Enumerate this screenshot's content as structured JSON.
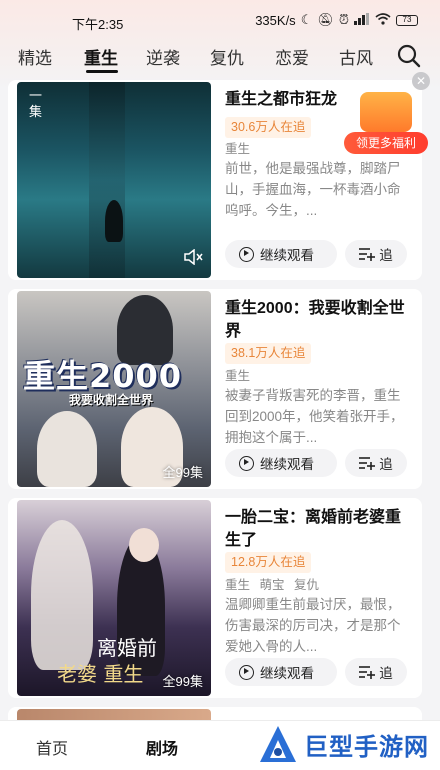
{
  "status_bar": {
    "time": "下午2:35",
    "network_speed": "335K/s",
    "battery": "73"
  },
  "tabs": [
    {
      "label": "精选",
      "active": false
    },
    {
      "label": "重生",
      "active": true
    },
    {
      "label": "逆袭",
      "active": false
    },
    {
      "label": "复仇",
      "active": false
    },
    {
      "label": "恋爱",
      "active": false
    },
    {
      "label": "古风",
      "active": false
    }
  ],
  "welfare": {
    "label": "领更多福利"
  },
  "dramas": [
    {
      "title": "重生之都市狂龙",
      "followers": "30.6万人在追",
      "tags": [
        "重生"
      ],
      "description": "前世，他是最强战尊，脚踏尸山，手握血海，一杯毒酒小命呜呼。今生，...",
      "episode_label": "一集",
      "continue_label": "继续观看",
      "follow_label": "追"
    },
    {
      "title": "重生2000：我要收割全世界",
      "followers": "38.1万人在追",
      "tags": [
        "重生"
      ],
      "description": "被妻子背叛害死的李晋，重生回到2000年，他笑着张开手，拥抱这个属于...",
      "episode_label": "全99集",
      "poster_title": "重生2000",
      "poster_subtitle": "我要收割全世界",
      "continue_label": "继续观看",
      "follow_label": "追"
    },
    {
      "title": "一胎二宝：离婚前老婆重生了",
      "followers": "12.8万人在追",
      "tags": [
        "重生",
        "萌宝",
        "复仇"
      ],
      "description": "温卿卿重生前最讨厌，最恨，伤害最深的厉司决，才是那个爱她入骨的人...",
      "episode_label": "全99集",
      "poster_title": "离婚前",
      "poster_subtitle": "老婆 重生",
      "continue_label": "继续观看",
      "follow_label": "追"
    }
  ],
  "bottom_nav": [
    {
      "label": "首页",
      "active": false
    },
    {
      "label": "剧场",
      "active": true
    }
  ],
  "watermark": {
    "text": "巨型手游网"
  }
}
